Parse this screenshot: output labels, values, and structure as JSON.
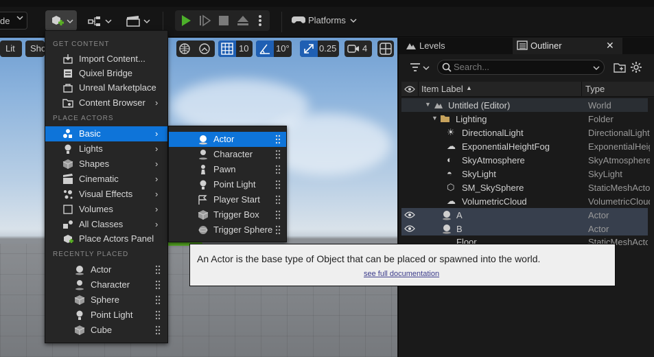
{
  "toolbar": {
    "mode_label": "de",
    "platforms_label": "Platforms"
  },
  "viewport": {
    "lit_label": "Lit",
    "show_label": "Sho",
    "grid_snap": "10",
    "rotation_snap": "10°",
    "scale_snap": "0.25",
    "camera_speed": "4"
  },
  "add_menu": {
    "get_content_header": "GET CONTENT",
    "get_content": [
      {
        "label": "Import Content...",
        "icon": "import-icon"
      },
      {
        "label": "Quixel Bridge",
        "icon": "bridge-icon"
      },
      {
        "label": "Unreal Marketplace",
        "icon": "marketplace-icon"
      },
      {
        "label": "Content Browser",
        "icon": "content-browser-icon",
        "has_submenu": true
      }
    ],
    "place_actors_header": "PLACE ACTORS",
    "place_actors": [
      {
        "label": "Basic",
        "icon": "basic-icon",
        "has_submenu": true,
        "highlighted": true
      },
      {
        "label": "Lights",
        "icon": "light-bulb-icon",
        "has_submenu": true
      },
      {
        "label": "Shapes",
        "icon": "cube-icon",
        "has_submenu": true
      },
      {
        "label": "Cinematic",
        "icon": "clapper-icon",
        "has_submenu": true
      },
      {
        "label": "Visual Effects",
        "icon": "particles-icon",
        "has_submenu": true
      },
      {
        "label": "Volumes",
        "icon": "volume-icon",
        "has_submenu": true
      },
      {
        "label": "All Classes",
        "icon": "classes-icon",
        "has_submenu": true
      },
      {
        "label": "Place Actors Panel",
        "icon": "place-actors-icon"
      }
    ],
    "recently_placed_header": "RECENTLY PLACED",
    "recently_placed": [
      {
        "label": "Actor",
        "icon": "actor-sphere-icon"
      },
      {
        "label": "Character",
        "icon": "character-icon"
      },
      {
        "label": "Sphere",
        "icon": "sphere-icon"
      },
      {
        "label": "Point Light",
        "icon": "point-light-icon"
      },
      {
        "label": "Cube",
        "icon": "cube-icon"
      }
    ]
  },
  "basic_submenu": [
    {
      "label": "Actor",
      "icon": "actor-sphere-icon",
      "highlighted": true
    },
    {
      "label": "Character",
      "icon": "character-icon"
    },
    {
      "label": "Pawn",
      "icon": "pawn-icon"
    },
    {
      "label": "Point Light",
      "icon": "point-light-icon"
    },
    {
      "label": "Player Start",
      "icon": "player-start-icon"
    },
    {
      "label": "Trigger Box",
      "icon": "trigger-box-icon"
    },
    {
      "label": "Trigger Sphere",
      "icon": "trigger-sphere-icon"
    }
  ],
  "tooltip": {
    "text": "An Actor is the base type of Object that can be placed or spawned into the world.",
    "link": "see full documentation"
  },
  "outliner": {
    "tab_levels": "Levels",
    "tab_outliner": "Outliner",
    "search_placeholder": "Search...",
    "col_label": "Item Label",
    "col_type": "Type",
    "rows": [
      {
        "label": "Untitled (Editor)",
        "type": "World"
      },
      {
        "label": "Lighting",
        "type": "Folder"
      },
      {
        "label": "DirectionalLight",
        "type": "DirectionalLight"
      },
      {
        "label": "ExponentialHeightFog",
        "type": "ExponentialHeightFog"
      },
      {
        "label": "SkyAtmosphere",
        "type": "SkyAtmosphere"
      },
      {
        "label": "SkyLight",
        "type": "SkyLight"
      },
      {
        "label": "SM_SkySphere",
        "type": "StaticMeshActor"
      },
      {
        "label": "VolumetricCloud",
        "type": "VolumetricCloud"
      },
      {
        "label": "A",
        "type": "Actor"
      },
      {
        "label": "B",
        "type": "Actor"
      },
      {
        "label": "Floor",
        "type": "StaticMeshActor"
      }
    ]
  },
  "colors": {
    "highlight": "#0e74d9",
    "play_green": "#4caf2a",
    "selected_row": "#373f4d"
  }
}
